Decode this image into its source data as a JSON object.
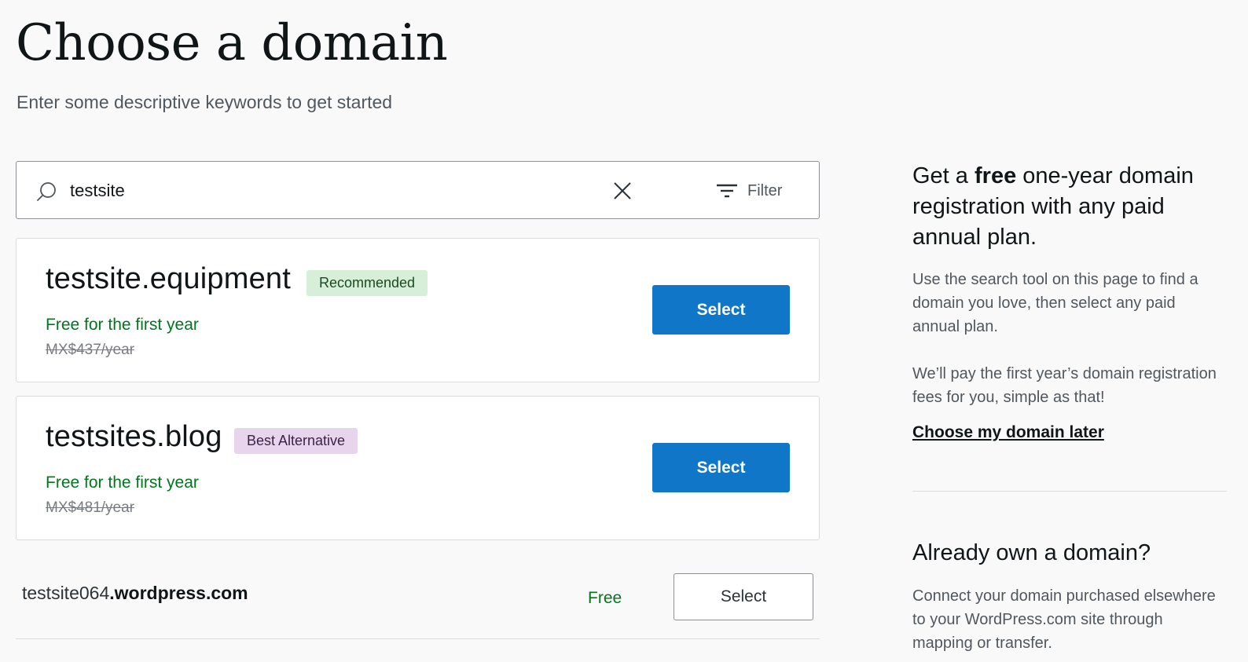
{
  "header": {
    "title": "Choose a domain",
    "subtitle": "Enter some descriptive keywords to get started"
  },
  "search": {
    "value": "testsite",
    "filter_label": "Filter"
  },
  "results": [
    {
      "domain": "testsite.equipment",
      "badge": "Recommended",
      "offer": "Free for the first year",
      "original_price": "MX$437/year",
      "action": "Select"
    },
    {
      "domain": "testsites.blog",
      "badge": "Best Alternative",
      "offer": "Free for the first year",
      "original_price": "MX$481/year",
      "action": "Select"
    }
  ],
  "free_option": {
    "subdomain": "testsite064",
    "suffix": ".wordpress.com",
    "price": "Free",
    "action": "Select"
  },
  "sidebar": {
    "promo_prefix": "Get a ",
    "promo_bold": "free",
    "promo_suffix": " one-year domain registration with any paid annual plan.",
    "promo_p1": "Use the search tool on this page to find a domain you love, then select any paid annual plan.",
    "promo_p2": "We’ll pay the first year’s domain registration fees for you, simple as that!",
    "later_link": "Choose my domain later",
    "own_title": "Already own a domain?",
    "own_text": "Connect your domain purchased elsewhere to your WordPress.com site through mapping or transfer."
  },
  "colors": {
    "primary": "#1077c8",
    "success_text": "#00761d",
    "recommended_badge": "#d7efd9",
    "alternative_badge": "#e6d5ec"
  }
}
